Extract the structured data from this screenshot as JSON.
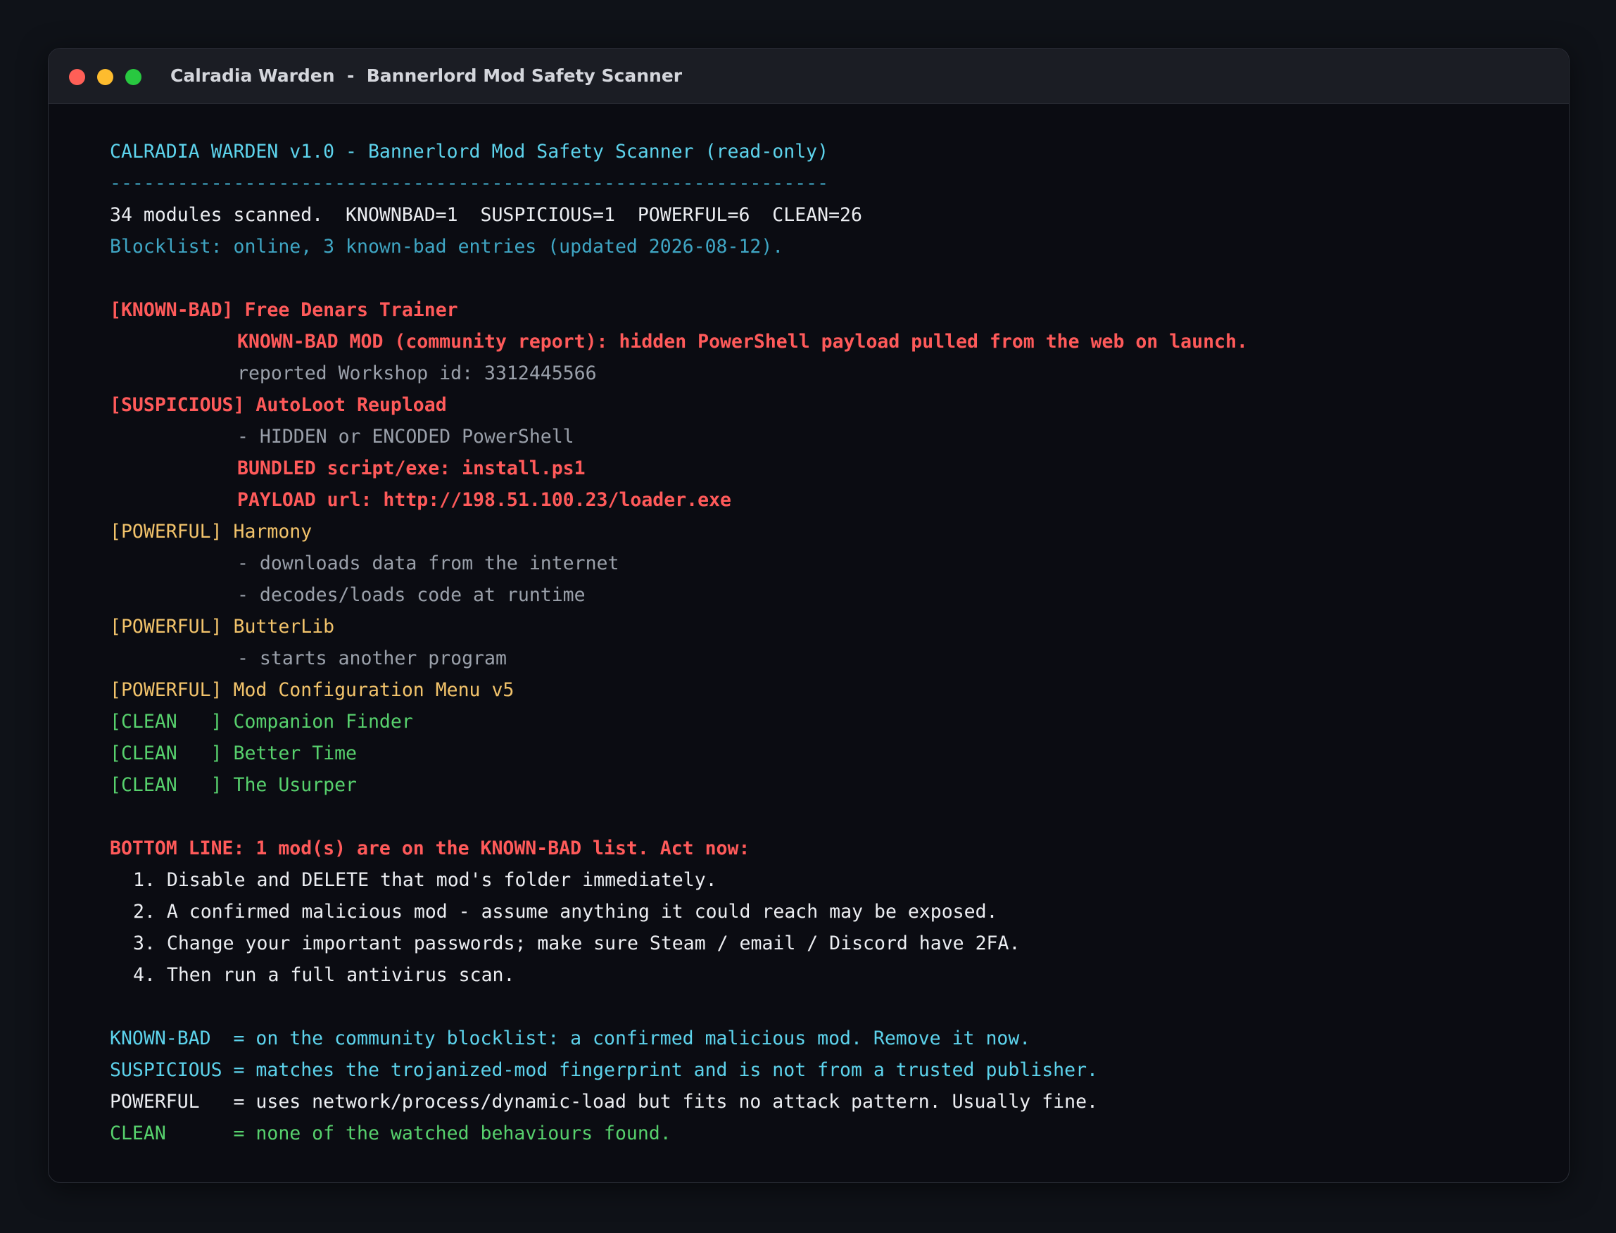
{
  "window": {
    "title": "Calradia Warden  -  Bannerlord Mod Safety Scanner",
    "controls": {
      "close_color": "#ff5f57",
      "minimize_color": "#febc2e",
      "zoom_color": "#28c840"
    }
  },
  "colors": {
    "known_bad": "#ff5a5a",
    "suspicious": "#ff5a5a",
    "powerful": "#f2c36b",
    "clean": "#57d16d",
    "header": "#5dd3ec",
    "detail": "#9aa0aa"
  },
  "header": {
    "title": "CALRADIA WARDEN v1.0 - Bannerlord Mod Safety Scanner (read-only)",
    "rule": "----------------------------------------------------------------",
    "summary": "34 modules scanned.  KNOWNBAD=1  SUSPICIOUS=1  POWERFUL=6  CLEAN=26",
    "blocklist": "Blocklist: online, 3 known-bad entries (updated 2026-08-12)."
  },
  "results": {
    "known_bad": {
      "tag": "[KNOWN-BAD]",
      "name": "Free Denars Trainer",
      "details": [
        "KNOWN-BAD MOD (community report): hidden PowerShell payload pulled from the web on launch.",
        "reported Workshop id: 3312445566"
      ]
    },
    "suspicious": {
      "tag": "[SUSPICIOUS]",
      "name": "AutoLoot Reupload",
      "details": [
        "- HIDDEN or ENCODED PowerShell",
        "BUNDLED script/exe: install.ps1",
        "PAYLOAD url: http://198.51.100.23/loader.exe"
      ]
    },
    "powerful": [
      {
        "tag": "[POWERFUL]",
        "name": "Harmony",
        "details": [
          "- downloads data from the internet",
          "- decodes/loads code at runtime"
        ]
      },
      {
        "tag": "[POWERFUL]",
        "name": "ButterLib",
        "details": [
          "- starts another program"
        ]
      },
      {
        "tag": "[POWERFUL]",
        "name": "Mod Configuration Menu v5",
        "details": []
      }
    ],
    "clean": [
      {
        "tag": "[CLEAN   ]",
        "name": "Companion Finder"
      },
      {
        "tag": "[CLEAN   ]",
        "name": "Better Time"
      },
      {
        "tag": "[CLEAN   ]",
        "name": "The Usurper"
      }
    ]
  },
  "bottom_line": {
    "heading": "BOTTOM LINE: 1 mod(s) are on the KNOWN-BAD list. Act now:",
    "steps": [
      "1. Disable and DELETE that mod's folder immediately.",
      "2. A confirmed malicious mod - assume anything it could reach may be exposed.",
      "3. Change your important passwords; make sure Steam / email / Discord have 2FA.",
      "4. Then run a full antivirus scan."
    ]
  },
  "legend": [
    {
      "term": "KNOWN-BAD ",
      "desc": " = on the community blocklist: a confirmed malicious mod. Remove it now."
    },
    {
      "term": "SUSPICIOUS",
      "desc": " = matches the trojanized-mod fingerprint and is not from a trusted publisher."
    },
    {
      "term": "POWERFUL  ",
      "desc": " = uses network/process/dynamic-load but fits no attack pattern. Usually fine."
    },
    {
      "term": "CLEAN     ",
      "desc": " = none of the watched behaviours found."
    }
  ]
}
